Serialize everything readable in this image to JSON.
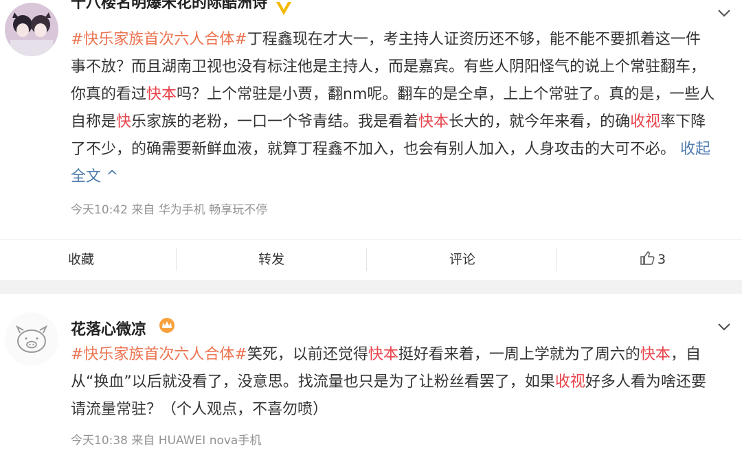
{
  "post1": {
    "username": "十八楼名明爆米花的际酷洲诗",
    "tag": "#快乐家族首次六人合体#",
    "lines": [
      [
        {
          "t": "#快乐家族首次六人合体#",
          "c": "tag"
        },
        {
          "t": "丁程鑫现在才大一，考主持人证资历还不够，能不能不要抓着这一件",
          "c": ""
        }
      ],
      [
        {
          "t": "事不放？而且湖南卫视也没有标注他是主持人，而是嘉宾。有些人阴阳怪气的说上个常驻翻车，",
          "c": ""
        }
      ],
      [
        {
          "t": "你真的看过",
          "c": ""
        },
        {
          "t": "快本",
          "c": "hl"
        },
        {
          "t": "吗？上个常驻是小贾，翻nm呢。翻车的是仝卓，上上个常驻了。真的是，一些人",
          "c": ""
        }
      ],
      [
        {
          "t": "自称是",
          "c": ""
        },
        {
          "t": "快",
          "c": "hl"
        },
        {
          "t": "乐家族的老粉，一口一个爷青结。我是看着",
          "c": ""
        },
        {
          "t": "快本",
          "c": "hl"
        },
        {
          "t": "长大的，就今年来看，的确",
          "c": ""
        },
        {
          "t": "收视",
          "c": "hl"
        },
        {
          "t": "率下降",
          "c": ""
        }
      ],
      [
        {
          "t": "了不少，的确需要新鲜血液，就算丁程鑫不加入，也会有别人加入，人身攻击的大可不必。 ",
          "c": ""
        },
        {
          "t": "收起",
          "c": "link"
        }
      ],
      [
        {
          "t": "全文 ^",
          "c": "link"
        }
      ]
    ],
    "meta": "今天10:42  来自 华为手机 畅享玩不停"
  },
  "actions": {
    "favorite": "收藏",
    "repost": "转发",
    "comment": "评论",
    "like_count": "3"
  },
  "post2": {
    "username": "花落心微凉",
    "lines": [
      [
        {
          "t": "#快乐家族首次六人合体#",
          "c": "tag"
        },
        {
          "t": "笑死，以前还觉得",
          "c": ""
        },
        {
          "t": "快本",
          "c": "hl"
        },
        {
          "t": "挺好看来着，一周上学就为了周六的",
          "c": ""
        },
        {
          "t": "快本",
          "c": "hl"
        },
        {
          "t": "，自",
          "c": ""
        }
      ],
      [
        {
          "t": "从“换血”以后就没看了，没意思。找流量也只是为了让粉丝看罢了，如果",
          "c": ""
        },
        {
          "t": "收视",
          "c": "hl"
        },
        {
          "t": "好多人看为啥还要",
          "c": ""
        }
      ],
      [
        {
          "t": "请流量常驻？（个人观点，不喜勿喷）",
          "c": ""
        }
      ]
    ],
    "meta": "今天10:38  来自 HUAWEI nova手机"
  },
  "colors": {
    "tag": "#eb7350",
    "highlight": "#e8444b",
    "link": "#507daf",
    "meta": "#939393"
  }
}
